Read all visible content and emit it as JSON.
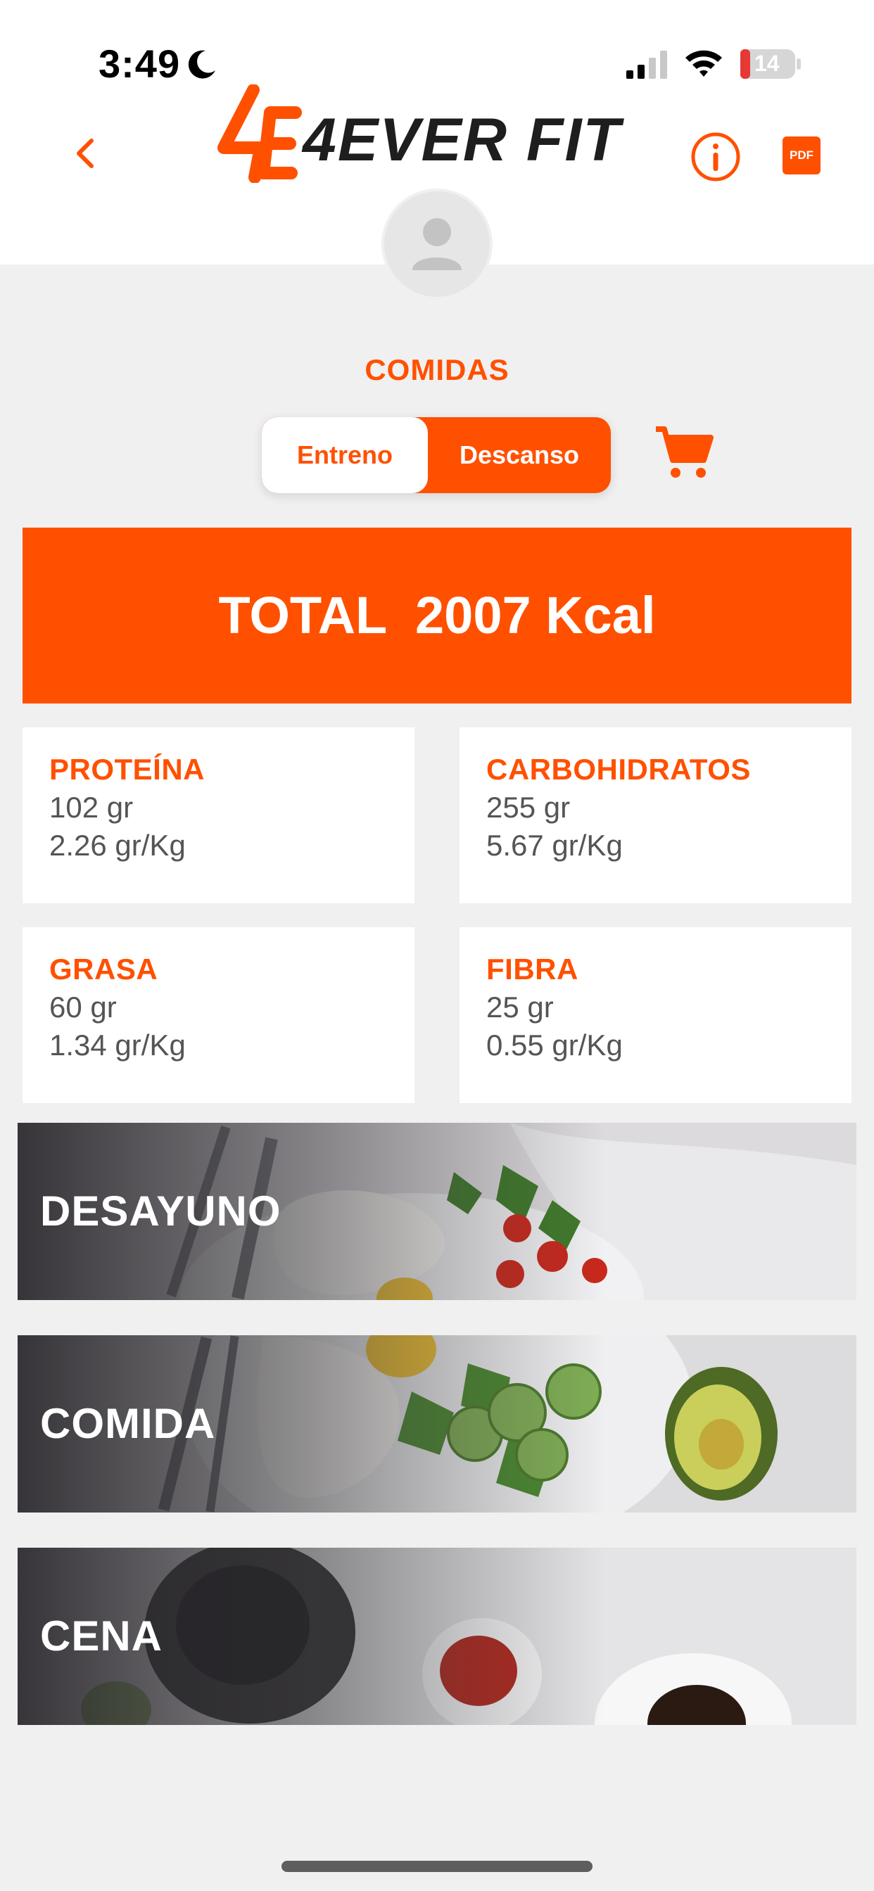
{
  "status_bar": {
    "time": "3:49",
    "battery_level": "14",
    "icons": [
      "moon-icon",
      "signal-icon",
      "wifi-icon",
      "battery-icon"
    ]
  },
  "header": {
    "logo_text": "4EVER FIT",
    "logo_mark": "4E",
    "pdf_label": "PDF",
    "icons": [
      "chevron-left-icon",
      "info-icon",
      "pdf-icon",
      "avatar-icon"
    ]
  },
  "section_title": "COMIDAS",
  "segmented": {
    "options": [
      "Entreno",
      "Descanso"
    ],
    "selected": "Entreno"
  },
  "cart_icon": "cart-icon",
  "total": {
    "label": "TOTAL  2007 Kcal"
  },
  "macros": [
    {
      "title": "PROTEÍNA",
      "grams": "102 gr",
      "per_kg": "2.26 gr/Kg"
    },
    {
      "title": "CARBOHIDRATOS",
      "grams": "255 gr",
      "per_kg": "5.67 gr/Kg"
    },
    {
      "title": "GRASA",
      "grams": "60 gr",
      "per_kg": "1.34 gr/Kg"
    },
    {
      "title": "FIBRA",
      "grams": "25 gr",
      "per_kg": "0.55 gr/Kg"
    }
  ],
  "meals": [
    {
      "label": "DESAYUNO"
    },
    {
      "label": "COMIDA"
    },
    {
      "label": "CENA"
    }
  ],
  "colors": {
    "accent": "#ff5000",
    "background": "#f0f0f0",
    "card": "#ffffff",
    "text_gray": "#555555"
  }
}
